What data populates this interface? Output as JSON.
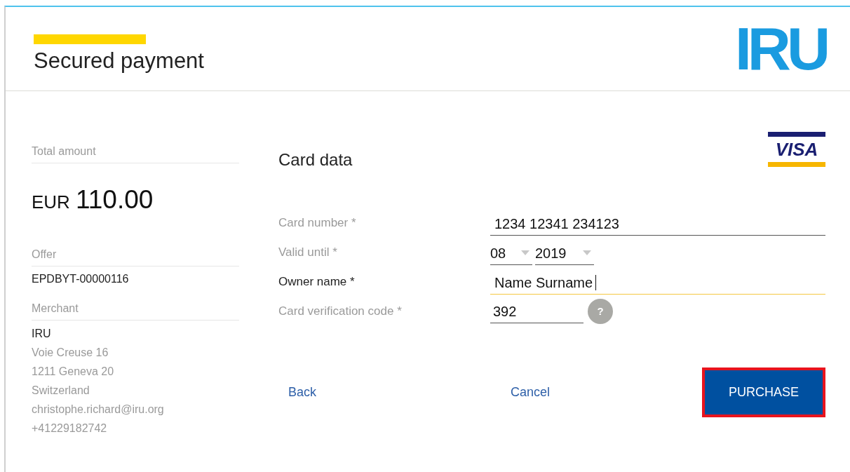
{
  "header": {
    "title": "Secured payment",
    "logo_text": "IRU"
  },
  "summary": {
    "total_label": "Total amount",
    "currency": "EUR",
    "amount": "110.00",
    "offer_label": "Offer",
    "offer_value": "EPDBYT-00000116",
    "merchant_label": "Merchant",
    "merchant_name": "IRU",
    "merchant_lines": [
      "Voie Creuse 16",
      "1211 Geneva 20",
      "Switzerland",
      "christophe.richard@iru.org",
      "+41229182742"
    ]
  },
  "card": {
    "title": "Card data",
    "brand_text": "VISA",
    "fields": [
      {
        "kind": "text",
        "label": "Card number *",
        "value": "1234 12341 234123",
        "focused": false
      },
      {
        "kind": "date",
        "label": "Valid until *",
        "month": "08",
        "year": "2019",
        "focused": false
      },
      {
        "kind": "text",
        "label": "Owner name *",
        "value": "Name Surname",
        "focused": true
      },
      {
        "kind": "cvc",
        "label": "Card verification code *",
        "value": "392",
        "help": "?",
        "focused": false
      }
    ]
  },
  "actions": {
    "back": "Back",
    "cancel": "Cancel",
    "purchase": "PURCHASE",
    "purchase_highlighted": true
  }
}
